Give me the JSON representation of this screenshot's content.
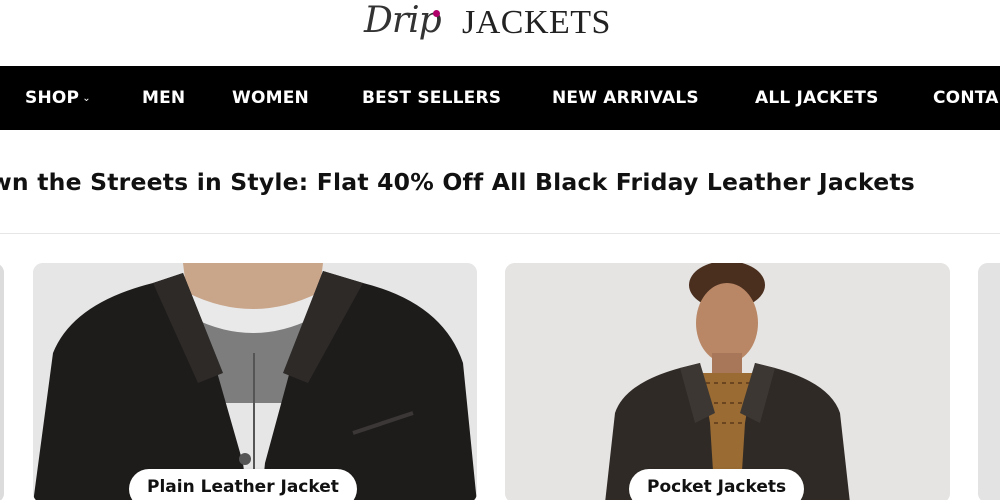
{
  "brand": {
    "script_text": "Drip",
    "word_text": "JACKETS",
    "accent_color": "#b0006a"
  },
  "nav": {
    "background": "#000000",
    "items": [
      {
        "label": "SHOP",
        "has_dropdown": true,
        "icon": "chevron-down-icon"
      },
      {
        "label": "MEN"
      },
      {
        "label": "WOMEN"
      },
      {
        "label": "BEST SELLERS"
      },
      {
        "label": "NEW ARRIVALS"
      },
      {
        "label": "ALL JACKETS"
      },
      {
        "label": "CONTA"
      }
    ]
  },
  "banner": {
    "text": "wn the Streets in Style: Flat 40% Off All Black Friday Leather Jackets"
  },
  "categories": [
    {
      "label": "Plain Leather Jacket",
      "image": "man-black-leather-jacket-grey-sweater"
    },
    {
      "label": "Pocket Jackets",
      "image": "man-dark-leather-jacket-plaid-shirt"
    }
  ]
}
